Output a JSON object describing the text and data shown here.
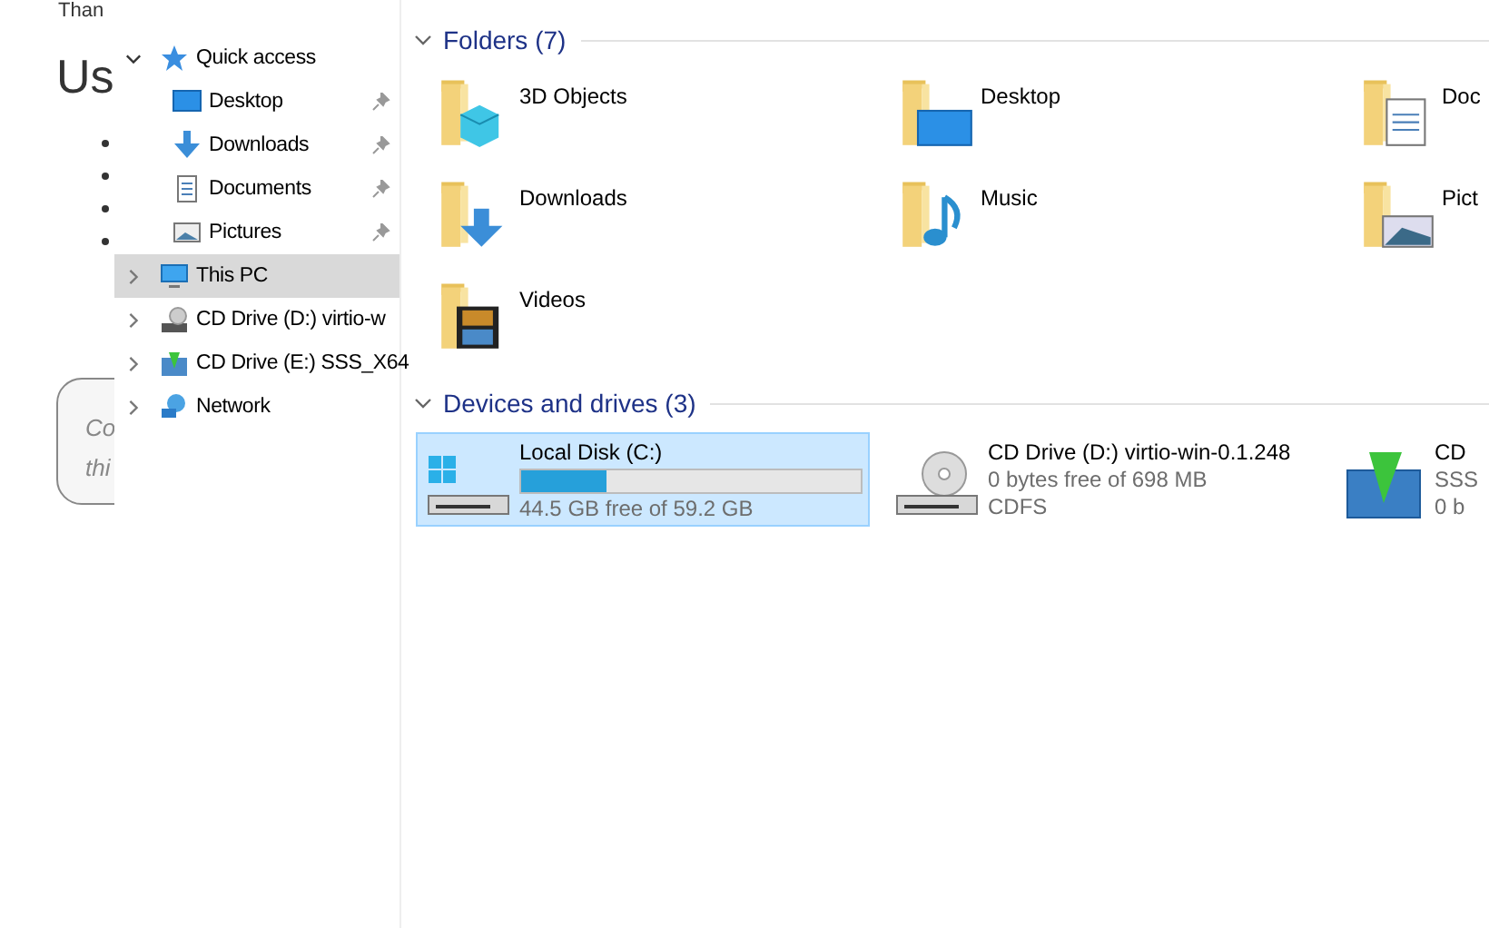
{
  "background_page": {
    "top_text": "Than",
    "heading": "Us",
    "note_lines": [
      "Co",
      "thi"
    ]
  },
  "navigation": {
    "items": [
      {
        "label": "Quick access",
        "kind": "star",
        "expanded": true,
        "selected": false,
        "children": [
          {
            "label": "Desktop",
            "kind": "desktop",
            "pinned": true,
            "selected": false
          },
          {
            "label": "Downloads",
            "kind": "download",
            "pinned": true,
            "selected": false
          },
          {
            "label": "Documents",
            "kind": "document",
            "pinned": true,
            "selected": false
          },
          {
            "label": "Pictures",
            "kind": "picture",
            "pinned": true,
            "selected": false
          }
        ]
      },
      {
        "label": "This PC",
        "kind": "pc",
        "expanded": false,
        "selected": true
      },
      {
        "label": "CD Drive (D:) virtio-w",
        "kind": "cd",
        "expanded": false,
        "selected": false
      },
      {
        "label": "CD Drive (E:) SSS_X64",
        "kind": "install",
        "expanded": false,
        "selected": false
      },
      {
        "label": "Network",
        "kind": "network",
        "expanded": false,
        "selected": false
      }
    ]
  },
  "folders": {
    "title": "Folders (7)",
    "items": [
      {
        "label": "3D Objects",
        "kind": "cube"
      },
      {
        "label": "Desktop",
        "kind": "desktop"
      },
      {
        "label": "Doc",
        "kind": "document"
      },
      {
        "label": "Downloads",
        "kind": "download"
      },
      {
        "label": "Music",
        "kind": "music"
      },
      {
        "label": "Pict",
        "kind": "picture"
      },
      {
        "label": "Videos",
        "kind": "film"
      }
    ]
  },
  "devices": {
    "title": "Devices and drives (3)",
    "items": [
      {
        "kind": "disk",
        "name": "Local Disk (C:)",
        "level": 0.25,
        "details": [
          "44.5 GB free of 59.2 GB"
        ],
        "selected": true
      },
      {
        "kind": "cd",
        "name": "CD Drive (D:) virtio-win-0.1.248",
        "details": [
          "0 bytes free of 698 MB",
          "CDFS"
        ],
        "selected": false
      },
      {
        "kind": "install",
        "name": "CD",
        "details": [
          "SSS",
          "0 b"
        ],
        "selected": false
      }
    ]
  }
}
